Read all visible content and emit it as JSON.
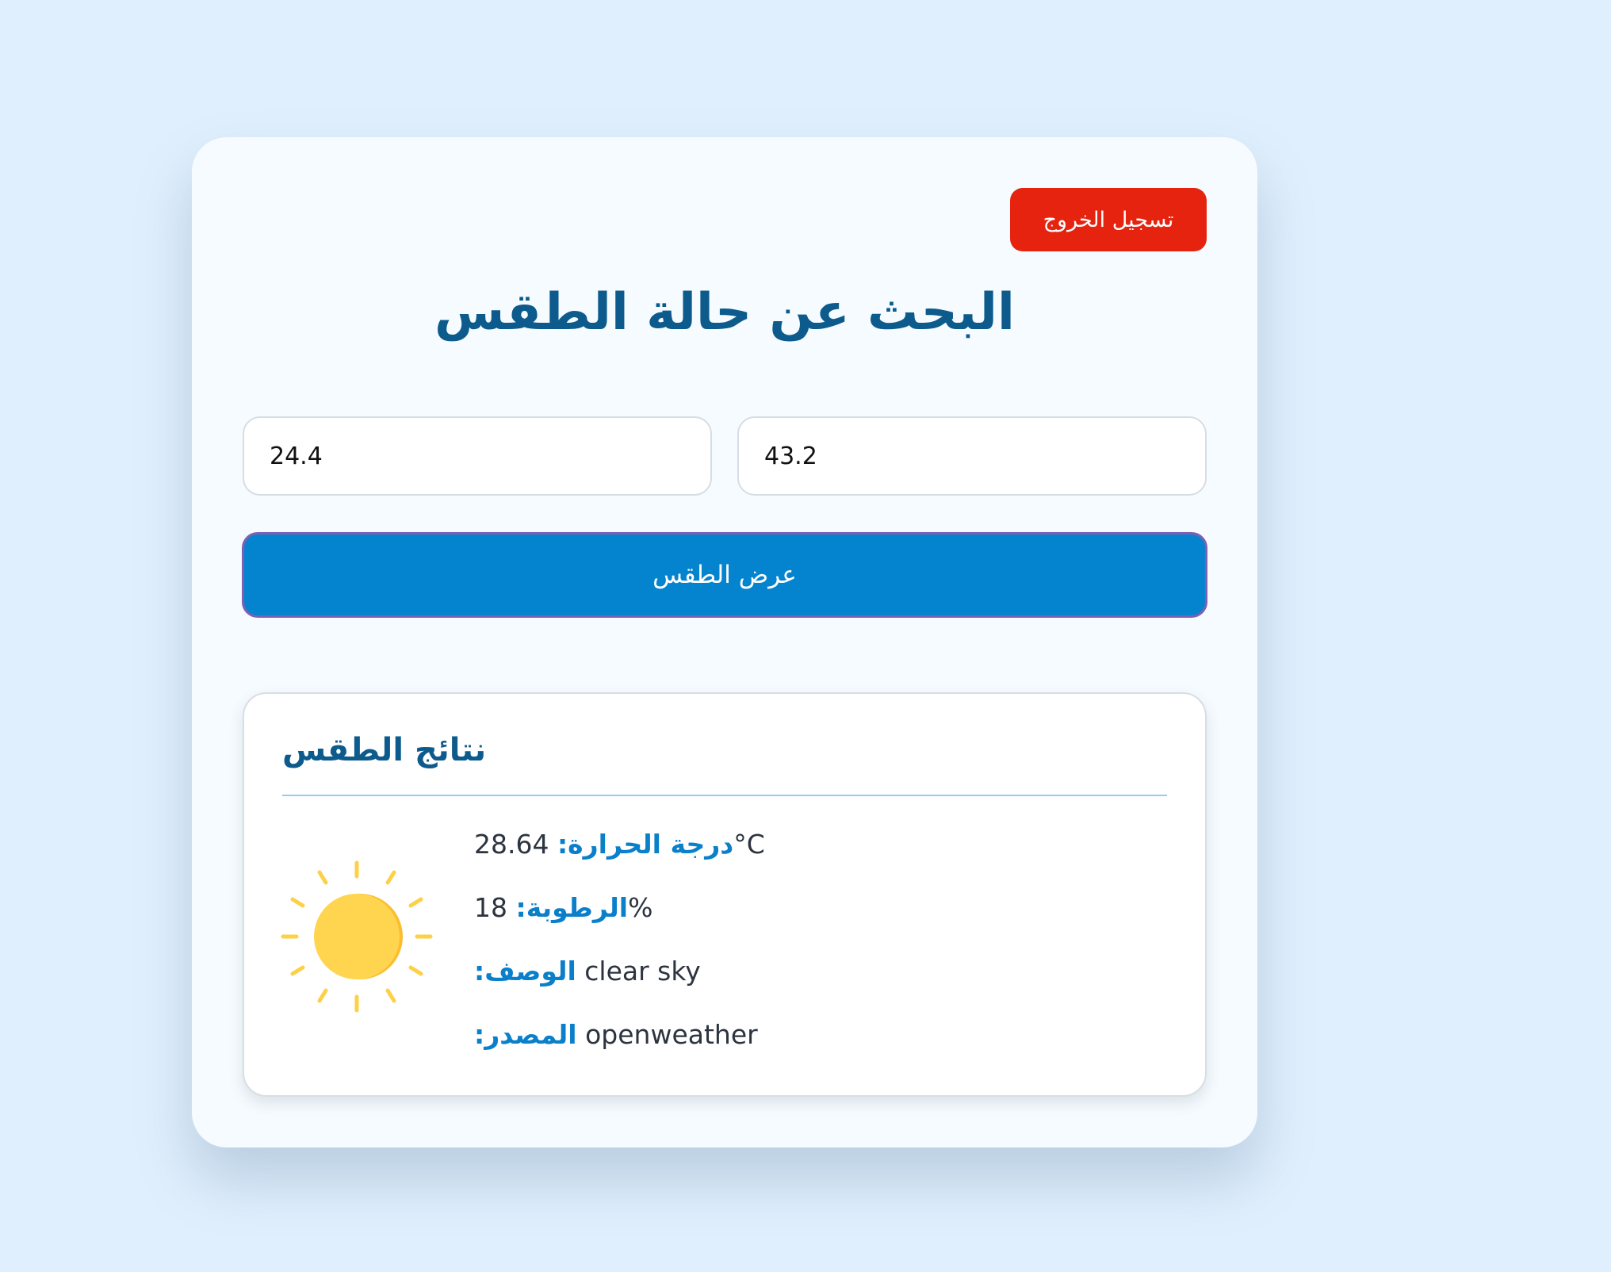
{
  "header": {
    "logout_label": "تسجيل الخروج",
    "title": "البحث عن حالة الطقس"
  },
  "form": {
    "longitude_value": "24.4",
    "latitude_value": "43.2",
    "submit_label": "عرض الطقس"
  },
  "results": {
    "title": "نتائج الطقس",
    "weather_icon": "sun-icon",
    "temperature_label": "درجة الحرارة:",
    "temperature_value": "28.64",
    "temperature_unit": "°C",
    "humidity_label": "الرطوبة:",
    "humidity_value": "18",
    "humidity_unit": "%",
    "description_label": "الوصف:",
    "description_value": "clear sky",
    "source_label": "المصدر:",
    "source_value": "openweather"
  },
  "colors": {
    "page_background": "#dfeffd",
    "title": "#0d5b8c",
    "label_accent": "#0a7fca",
    "logout_button": "#e5230f",
    "primary_button": "#0484cf"
  }
}
